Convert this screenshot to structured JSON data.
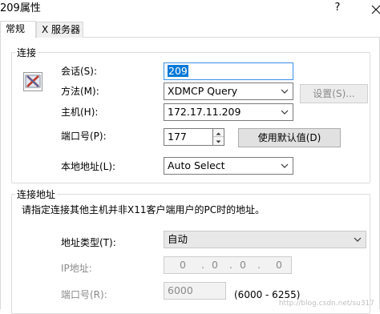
{
  "window": {
    "title": "209属性",
    "help_glyph": "?"
  },
  "tabs": [
    {
      "label": "常规",
      "active": true
    },
    {
      "label": "X 服务器",
      "active": false
    }
  ],
  "connection": {
    "legend": "连接",
    "session_label": "会话(S):",
    "session_value": "209",
    "method_label": "方法(M):",
    "method_value": "XDMCP Query",
    "settings_button": "设置(S)...",
    "host_label": "主机(H):",
    "host_value": "172.17.11.209",
    "port_label": "端口号(P):",
    "port_value": "177",
    "default_button": "使用默认值(D)",
    "local_addr_label": "本地地址(L):",
    "local_addr_value": "Auto Select"
  },
  "connection_address": {
    "legend": "连接地址",
    "description": "请指定连接其他主机并非X11客户端用户的PC时的地址。",
    "addr_type_label": "地址类型(T):",
    "addr_type_value": "自动",
    "ip_label": "IP地址:",
    "ip_octets": [
      "0",
      "0",
      "0",
      "0"
    ],
    "ip_separator": ".",
    "port_label": "端口号(R):",
    "port_value": "6000",
    "port_range": "(6000 - 6255)"
  },
  "watermark": "http://blog.csdn.net/su317",
  "colors": {
    "selection": "#0078d7",
    "focus_border": "#3c8ee6",
    "disabled_text": "#8a8a8a"
  }
}
